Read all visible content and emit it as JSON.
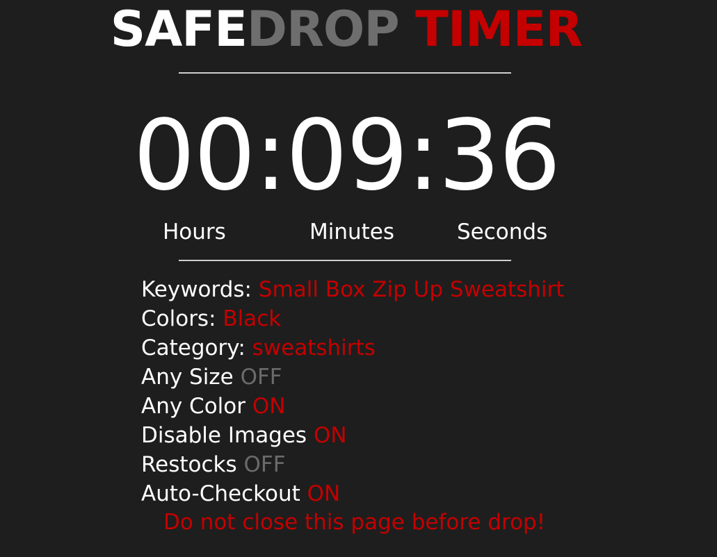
{
  "header": {
    "title_part1": "SAFE",
    "title_part2": "DROP",
    "title_part3": "TIMER"
  },
  "timer": {
    "hours": "00",
    "minutes": "09",
    "seconds": "36",
    "separator": ":",
    "labels": {
      "hours": "Hours",
      "minutes": "Minutes",
      "seconds": "Seconds"
    }
  },
  "settings": {
    "keywords_label": "Keywords:",
    "keywords_value": "Small Box Zip Up Sweatshirt",
    "colors_label": "Colors:",
    "colors_value": "Black",
    "category_label": "Category:",
    "category_value": "sweatshirts",
    "any_size_label": "Any Size",
    "any_size_value": "OFF",
    "any_color_label": "Any Color",
    "any_color_value": "ON",
    "disable_images_label": "Disable Images",
    "disable_images_value": "ON",
    "restocks_label": "Restocks",
    "restocks_value": "OFF",
    "auto_checkout_label": "Auto-Checkout",
    "auto_checkout_value": "ON"
  },
  "warning": "Do not close this page before drop!",
  "colors": {
    "background": "#1e1e1e",
    "accent_red": "#c40000",
    "muted_gray": "#6b6b6b",
    "text_white": "#ffffff"
  }
}
